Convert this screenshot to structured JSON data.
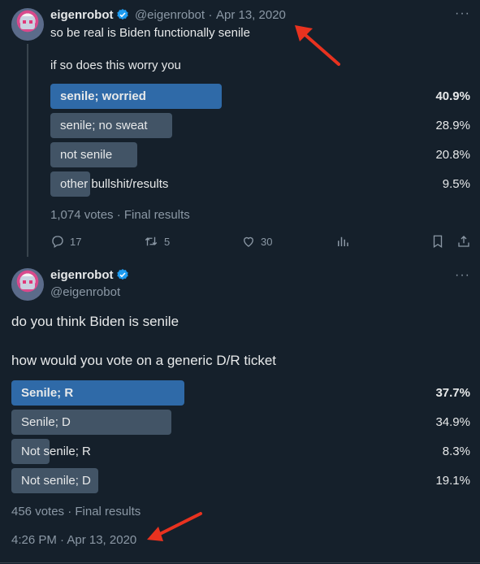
{
  "colors": {
    "background": "#15202b",
    "bar_winner": "#2f6aa8",
    "bar_other": "#425466",
    "verified": "#1d9bf0",
    "arrow": "#e8321f"
  },
  "tweet1": {
    "name": "eigenrobot",
    "handle": "@eigenrobot",
    "separator": "·",
    "date": "Apr 13, 2020",
    "line1": "so be real is Biden functionally senile",
    "line2": "if so does this worry you",
    "poll": [
      {
        "label": "senile; worried",
        "percent": "40.9%",
        "value": 40.9,
        "winner": true
      },
      {
        "label": "senile; no sweat",
        "percent": "28.9%",
        "value": 28.9,
        "winner": false
      },
      {
        "label": "not senile",
        "percent": "20.8%",
        "value": 20.8,
        "winner": false
      },
      {
        "label": "other bullshit/results",
        "percent": "9.5%",
        "value": 9.5,
        "winner": false
      }
    ],
    "poll_meta": "1,074 votes · Final results",
    "replies": "17",
    "retweets": "5",
    "likes": "30"
  },
  "tweet2": {
    "name": "eigenrobot",
    "handle": "@eigenrobot",
    "line1": "do you think Biden is senile",
    "line2": "how would you vote on a generic D/R ticket",
    "poll": [
      {
        "label": "Senile; R",
        "percent": "37.7%",
        "value": 37.7,
        "winner": true
      },
      {
        "label": "Senile; D",
        "percent": "34.9%",
        "value": 34.9,
        "winner": false
      },
      {
        "label": "Not senile; R",
        "percent": "8.3%",
        "value": 8.3,
        "winner": false
      },
      {
        "label": "Not senile; D",
        "percent": "19.1%",
        "value": 19.1,
        "winner": false
      }
    ],
    "poll_meta": "456 votes · Final results",
    "timestamp": "4:26 PM · Apr 13, 2020"
  },
  "icons": [
    "more-icon",
    "verified-badge-icon",
    "reply-icon",
    "retweet-icon",
    "like-icon",
    "analytics-icon",
    "bookmark-icon",
    "share-icon",
    "arrow-annotation"
  ]
}
